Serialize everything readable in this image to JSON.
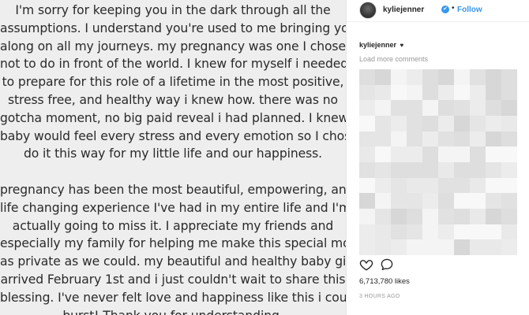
{
  "note": {
    "paragraph1": [
      "I'm sorry for keeping you in the dark through all the",
      "assumptions. I understand you're used to me bringing you",
      "along on all my journeys. my pregnancy was one I chose",
      "not to do in front of the world. I knew for myself i needed",
      "to prepare for this role of a lifetime in the most positive,",
      "stress free, and healthy way i knew how. there was no",
      "gotcha moment, no big paid reveal i had planned. I knew my",
      "baby would feel every stress and every emotion so I chose to",
      "do it this way for my little life and our happiness."
    ],
    "paragraph2": [
      "pregnancy has been the most beautiful, empowering, and",
      "life changing experience I've had in my entire life and I'm",
      "actually going to miss it. I appreciate my friends and",
      "especially my family for helping me make this special moment",
      "as private as we could. my beautiful and healthy baby girl",
      "arrived February 1st and i just couldn't wait to share this",
      "blessing. I've never felt love and happiness like this i could",
      "burst! Thank you for understanding."
    ]
  },
  "header": {
    "username": "kyliejenner",
    "verified_icon": "✔",
    "separator": "•",
    "follow_label": "Follow"
  },
  "caption": {
    "username": "kyliejenner",
    "heart": "♥"
  },
  "comments": {
    "load_more_label": "Load more comments"
  },
  "stats": {
    "likes_text": "6,713,780 likes",
    "time_text": "3 HOURS AGO"
  },
  "icons": {
    "like": "heart-outline-icon",
    "comment": "comment-bubble-icon"
  },
  "colors": {
    "accent": "#3897f0",
    "text": "#262626",
    "muted": "#999999"
  }
}
